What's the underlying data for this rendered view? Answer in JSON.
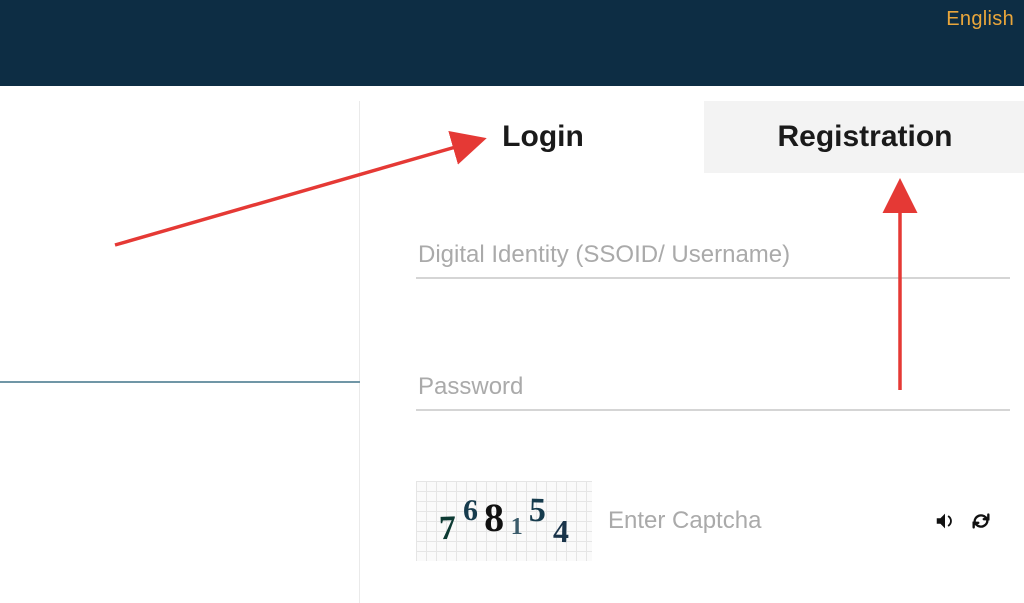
{
  "header": {
    "language_label": "English"
  },
  "tabs": {
    "login_label": "Login",
    "registration_label": "Registration"
  },
  "form": {
    "identity_placeholder": "Digital Identity (SSOID/ Username)",
    "password_placeholder": "Password",
    "captcha_placeholder": "Enter Captcha"
  },
  "captcha": {
    "d1": "7",
    "d2": "6",
    "d3": "8",
    "d4": "1",
    "d5": "5",
    "d6": "4"
  },
  "icons": {
    "audio": "captcha-audio-icon",
    "refresh": "captcha-refresh-icon"
  },
  "colors": {
    "topbar_bg": "#0d2d44",
    "lang_link": "#e9a63b",
    "annotation": "#e53935"
  }
}
